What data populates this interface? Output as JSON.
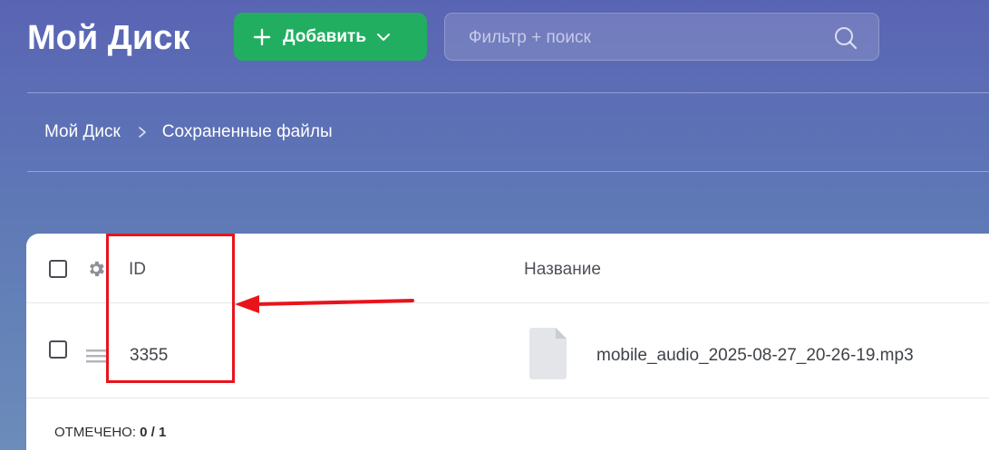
{
  "header": {
    "title": "Мой Диск",
    "add_button": {
      "label": "Добавить",
      "icon": "plus-icon",
      "dropdown_icon": "chevron-down-icon"
    },
    "search": {
      "placeholder": "Фильтр + поиск",
      "value": "",
      "icon": "search-icon"
    }
  },
  "breadcrumb": {
    "items": [
      "Мой Диск",
      "Сохраненные файлы"
    ],
    "separator_icon": "chevron-right-icon"
  },
  "table": {
    "columns": {
      "id": "ID",
      "name": "Название"
    },
    "settings_icon": "gear-icon",
    "rows": [
      {
        "id": "3355",
        "name": "mobile_audio_2025-08-27_20-26-19.mp3",
        "icon": "file-icon",
        "selected": false
      }
    ],
    "footer": {
      "selected_label": "ОТМЕЧЕНО:",
      "selected_count": "0 / 1"
    }
  },
  "annotation": {
    "highlight_color": "#e8141c",
    "arrow_color": "#e8141c"
  },
  "colors": {
    "add_button": "#22ae61",
    "background_top": "#5a64b4",
    "background_bottom": "#6c8cba"
  }
}
